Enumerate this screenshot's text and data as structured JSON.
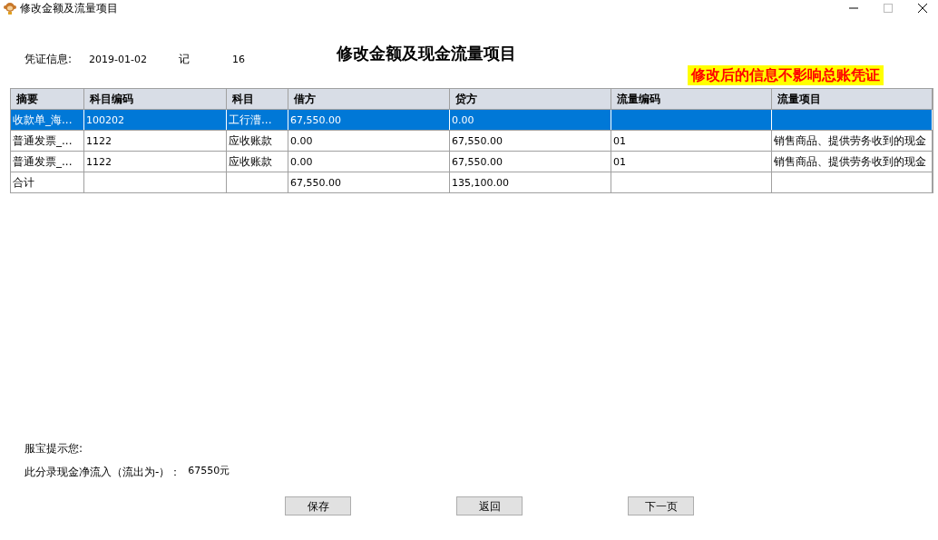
{
  "window": {
    "title": "修改金额及流量项目"
  },
  "voucher": {
    "label": "凭证信息:",
    "date": "2019-01-02",
    "type": "记",
    "number": "16"
  },
  "heading": "修改金额及现金流量项目",
  "notice": "修改后的信息不影响总账凭证",
  "table": {
    "columns": [
      "摘要",
      "科目编码",
      "科目",
      "借方",
      "贷方",
      "流量编码",
      "流量项目"
    ],
    "rows": [
      {
        "selected": true,
        "cells": [
          "收款单_海...",
          "100202",
          "工行漕...",
          "67,550.00",
          "0.00",
          "",
          ""
        ]
      },
      {
        "selected": false,
        "cells": [
          "普通发票_...",
          "1122",
          "应收账款",
          "0.00",
          "67,550.00",
          "01",
          "销售商品、提供劳务收到的现金"
        ]
      },
      {
        "selected": false,
        "cells": [
          "普通发票_...",
          "1122",
          "应收账款",
          "0.00",
          "67,550.00",
          "01",
          "销售商品、提供劳务收到的现金"
        ]
      },
      {
        "selected": false,
        "cells": [
          "合计",
          "",
          "",
          "67,550.00",
          "135,100.00",
          "",
          ""
        ]
      }
    ]
  },
  "tip": {
    "title": "服宝提示您:",
    "label": "此分录现金净流入（流出为-）：",
    "value": "67550元"
  },
  "buttons": [
    "保存",
    "返回",
    "下一页"
  ]
}
